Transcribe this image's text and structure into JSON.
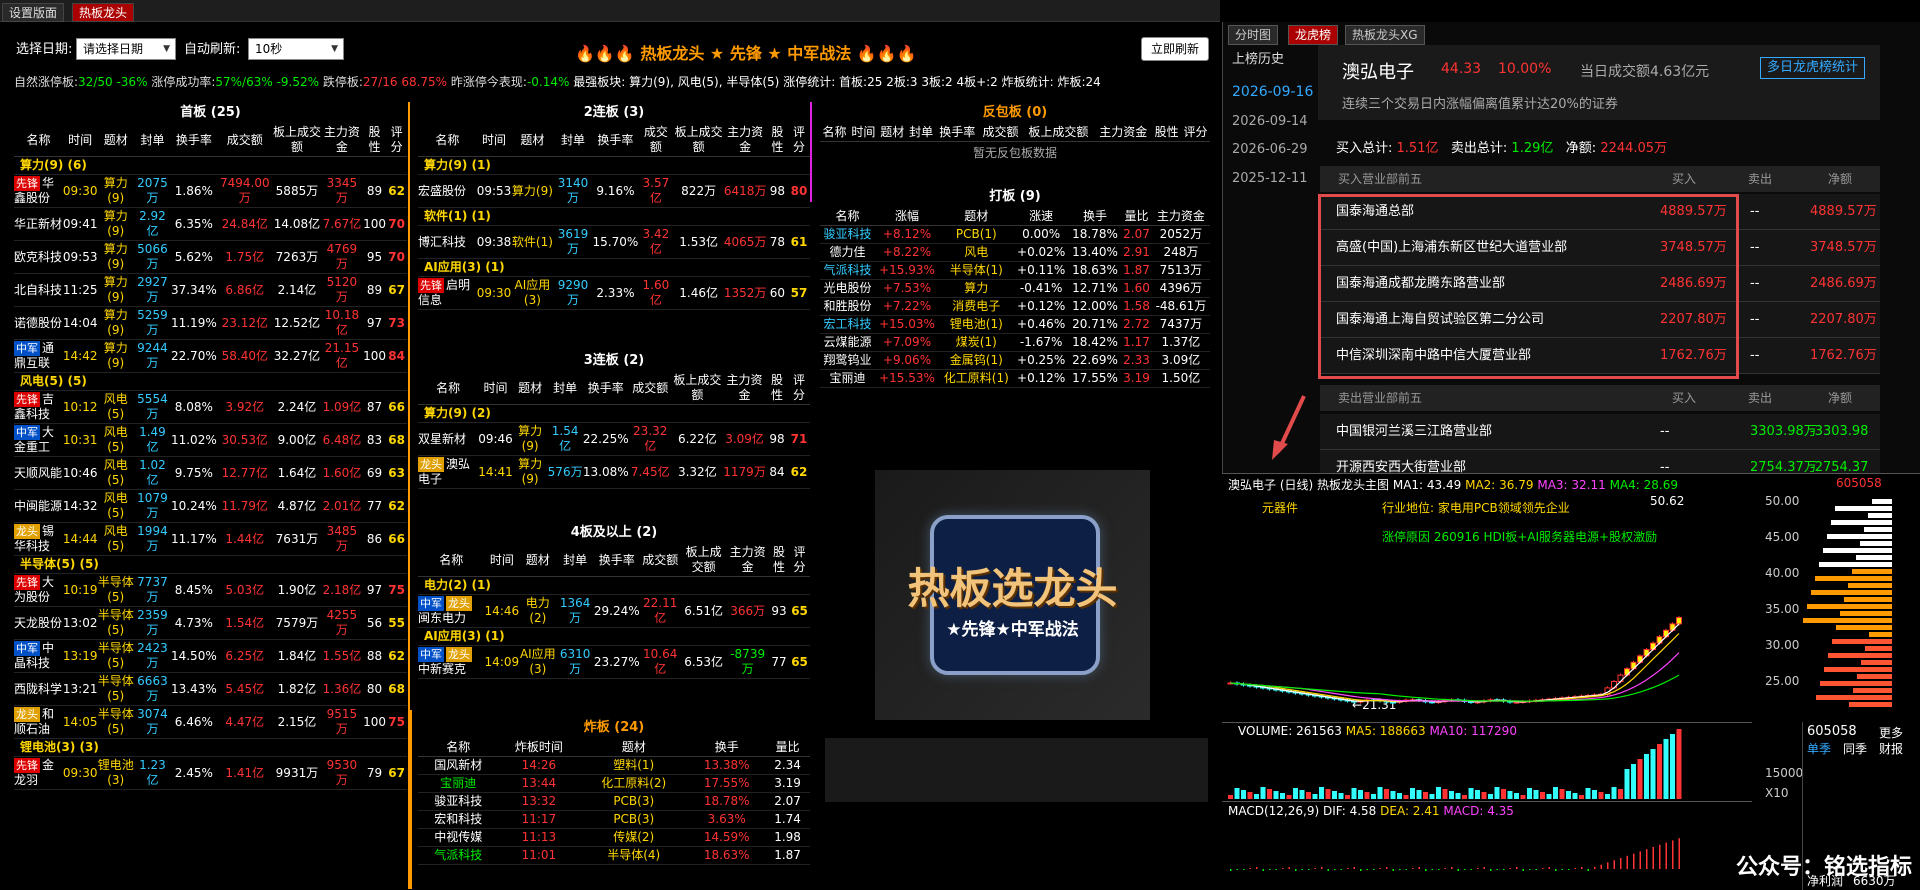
{
  "tabs": [
    "设置版面",
    "热板龙头"
  ],
  "toolbar": {
    "date_label": "选择日期:",
    "date_value": "请选择日期",
    "refresh_label": "自动刷新:",
    "refresh_value": "10秒",
    "title": "🔥🔥🔥 热板龙头 ★ 先锋 ★ 中军战法 🔥🔥🔥",
    "refresh_button": "立即刷新"
  },
  "stats": {
    "l1": "自然涨停板:",
    "v1": "32/50",
    "v2": "-36%",
    "l2": "涨停成功率:",
    "v3": "57%/63%",
    "v4": "-9.52%",
    "l3": "跌停板:",
    "v5": "27/16",
    "v6": "68.75%",
    "l4": "昨涨停今表现:",
    "v7": "-0.14%",
    "l5": "最强板块: 算力(9), 风电(5), 半导体(5)",
    "l6": "涨停统计: 首板:25 2板:3 3板:2 4板+:2 炸板统计: 炸板:24"
  },
  "headers": {
    "first": [
      "名称",
      "时间",
      "题材",
      "封单",
      "换手率",
      "成交额",
      "板上成交额",
      "主力资金",
      "股性",
      "评分"
    ],
    "dragon": [
      "名称",
      "涨幅",
      "题材",
      "涨速",
      "换手",
      "量比",
      "主力资金"
    ],
    "zhaban": [
      "名称",
      "炸板时间",
      "题材",
      "换手",
      "量比"
    ]
  },
  "first_board": {
    "title": "首板 (25)",
    "groups": [
      {
        "name": "算力(9) (6)",
        "rows": [
          {
            "badge": "先锋",
            "badge_type": "x",
            "name": "华鑫股份",
            "time": "09:30",
            "topic": "算力(9)",
            "seal": "2075万",
            "turn": "1.86%",
            "amount": "7494.00万",
            "board": "5885万",
            "main": "3345万",
            "xg": "89",
            "score": "62"
          },
          {
            "badge": "",
            "name": "华正新材",
            "time": "09:41",
            "topic": "算力(9)",
            "seal": "2.92亿",
            "turn": "6.35%",
            "amount": "24.84亿",
            "board": "14.08亿",
            "main": "7.67亿",
            "xg": "100",
            "score": "70"
          },
          {
            "badge": "",
            "name": "欧克科技",
            "time": "09:53",
            "topic": "算力(9)",
            "seal": "5066万",
            "turn": "5.62%",
            "amount": "1.75亿",
            "board": "7263万",
            "main": "4769万",
            "xg": "95",
            "score": "70"
          },
          {
            "badge": "",
            "name": "北自科技",
            "time": "11:25",
            "topic": "算力(9)",
            "seal": "2927万",
            "turn": "37.34%",
            "amount": "6.86亿",
            "board": "2.14亿",
            "main": "5120万",
            "xg": "89",
            "score": "67"
          },
          {
            "badge": "",
            "name": "诺德股份",
            "time": "14:04",
            "topic": "算力(9)",
            "seal": "5259万",
            "turn": "11.19%",
            "amount": "23.12亿",
            "board": "12.52亿",
            "main": "10.18亿",
            "xg": "97",
            "score": "73"
          },
          {
            "badge": "中军",
            "badge_type": "z",
            "name": "通鼎互联",
            "time": "14:42",
            "topic": "算力(9)",
            "seal": "9244万",
            "turn": "22.70%",
            "amount": "58.40亿",
            "board": "32.27亿",
            "main": "21.15亿",
            "xg": "100",
            "score": "84"
          }
        ]
      },
      {
        "name": "风电(5) (5)",
        "rows": [
          {
            "badge": "先锋",
            "badge_type": "x",
            "name": "吉鑫科技",
            "time": "10:12",
            "topic": "风电(5)",
            "seal": "5554万",
            "turn": "8.08%",
            "amount": "3.92亿",
            "board": "2.24亿",
            "main": "1.09亿",
            "xg": "87",
            "score": "66"
          },
          {
            "badge": "中军",
            "badge_type": "z",
            "name": "大金重工",
            "time": "10:31",
            "topic": "风电(5)",
            "seal": "1.49亿",
            "turn": "11.02%",
            "amount": "30.53亿",
            "board": "9.00亿",
            "main": "6.48亿",
            "xg": "83",
            "score": "68"
          },
          {
            "badge": "",
            "name": "天顺风能",
            "time": "10:46",
            "topic": "风电(5)",
            "seal": "1.02亿",
            "turn": "9.75%",
            "amount": "12.77亿",
            "board": "1.64亿",
            "main": "1.60亿",
            "xg": "69",
            "score": "63"
          },
          {
            "badge": "",
            "name": "中闽能源",
            "time": "14:32",
            "topic": "风电(5)",
            "seal": "1079万",
            "turn": "10.24%",
            "amount": "11.79亿",
            "board": "4.87亿",
            "main": "2.01亿",
            "xg": "77",
            "score": "62"
          },
          {
            "badge": "龙头",
            "badge_type": "l",
            "name": "锡华科技",
            "time": "14:44",
            "topic": "风电(5)",
            "seal": "1994万",
            "turn": "11.17%",
            "amount": "1.44亿",
            "board": "7631万",
            "main": "3485万",
            "xg": "86",
            "score": "66"
          }
        ]
      },
      {
        "name": "半导体(5) (5)",
        "rows": [
          {
            "badge": "先锋",
            "badge_type": "x",
            "name": "大为股份",
            "time": "10:19",
            "topic": "半导体(5)",
            "seal": "7737万",
            "turn": "8.45%",
            "amount": "5.03亿",
            "board": "1.90亿",
            "main": "2.18亿",
            "xg": "97",
            "score": "75"
          },
          {
            "badge": "",
            "name": "天龙股份",
            "time": "13:02",
            "topic": "半导体(5)",
            "seal": "2359万",
            "turn": "4.73%",
            "amount": "1.54亿",
            "board": "7579万",
            "main": "4255万",
            "xg": "56",
            "score": "55"
          },
          {
            "badge": "中军",
            "badge_type": "z",
            "name": "中晶科技",
            "time": "13:19",
            "topic": "半导体(5)",
            "seal": "2423万",
            "turn": "14.50%",
            "amount": "6.25亿",
            "board": "1.84亿",
            "main": "1.55亿",
            "xg": "88",
            "score": "62"
          },
          {
            "badge": "",
            "name": "西陇科学",
            "time": "13:21",
            "topic": "半导体(5)",
            "seal": "6663万",
            "turn": "13.43%",
            "amount": "5.45亿",
            "board": "1.82亿",
            "main": "1.36亿",
            "xg": "80",
            "score": "68"
          },
          {
            "badge": "龙头",
            "badge_type": "l",
            "name": "和顺石油",
            "time": "14:05",
            "topic": "半导体(5)",
            "seal": "3074万",
            "turn": "6.46%",
            "amount": "4.47亿",
            "board": "2.15亿",
            "main": "9515万",
            "xg": "100",
            "score": "75"
          }
        ]
      },
      {
        "name": "锂电池(3) (3)",
        "rows": [
          {
            "badge": "先锋",
            "badge_type": "x",
            "name": "金龙羽",
            "time": "09:30",
            "topic": "锂电池(3)",
            "seal": "1.23亿",
            "turn": "2.45%",
            "amount": "1.41亿",
            "board": "9931万",
            "main": "9530万",
            "xg": "79",
            "score": "67"
          }
        ]
      }
    ]
  },
  "second_board": {
    "title": "2连板 (3)",
    "groups": [
      {
        "name": "算力(9) (1)",
        "rows": [
          {
            "badge": "",
            "name": "宏盛股份",
            "time": "09:53",
            "topic": "算力(9)",
            "seal": "3140万",
            "turn": "9.16%",
            "amount": "3.57亿",
            "board": "822万",
            "main": "6418万",
            "xg": "98",
            "score": "80"
          }
        ]
      },
      {
        "name": "软件(1) (1)",
        "rows": [
          {
            "badge": "",
            "name": "博汇科技",
            "time": "09:38",
            "topic": "软件(1)",
            "seal": "3619万",
            "turn": "15.70%",
            "amount": "3.42亿",
            "board": "1.53亿",
            "main": "4065万",
            "xg": "78",
            "score": "61"
          }
        ]
      },
      {
        "name": "AI应用(3) (1)",
        "rows": [
          {
            "badge": "先锋",
            "badge_type": "x",
            "name": "启明信息",
            "time": "09:30",
            "topic": "AI应用(3)",
            "seal": "9290万",
            "turn": "2.33%",
            "amount": "1.60亿",
            "board": "1.46亿",
            "main": "1352万",
            "xg": "60",
            "score": "57"
          }
        ]
      }
    ]
  },
  "third_board": {
    "title": "3连板 (2)",
    "groups": [
      {
        "name": "算力(9) (2)",
        "rows": [
          {
            "badge": "",
            "name": "双星新材",
            "time": "09:46",
            "topic": "算力(9)",
            "seal": "1.54亿",
            "turn": "22.25%",
            "amount": "23.32亿",
            "board": "6.22亿",
            "main": "3.09亿",
            "xg": "98",
            "score": "71"
          },
          {
            "badge": "龙头",
            "badge_type": "l",
            "name": "澳弘电子",
            "time": "14:41",
            "topic": "算力(9)",
            "seal": "576万",
            "turn": "13.08%",
            "amount": "7.45亿",
            "board": "3.32亿",
            "main": "1179万",
            "xg": "84",
            "score": "62"
          }
        ]
      }
    ]
  },
  "fourth_board": {
    "title": "4板及以上 (2)",
    "groups": [
      {
        "name": "电力(2) (1)",
        "rows": [
          {
            "badge": "中军",
            "badge_type": "z",
            "badge2": "龙头",
            "name": "闽东电力",
            "time": "14:46",
            "topic": "电力(2)",
            "seal": "1364万",
            "turn": "29.24%",
            "amount": "22.11亿",
            "board": "6.51亿",
            "main": "366万",
            "xg": "93",
            "score": "65"
          }
        ]
      },
      {
        "name": "AI应用(3) (1)",
        "rows": [
          {
            "badge": "中军",
            "badge_type": "z",
            "badge2": "龙头",
            "name": "中新赛克",
            "time": "14:09",
            "topic": "AI应用(3)",
            "seal": "6310万",
            "turn": "23.27%",
            "amount": "10.64亿",
            "board": "6.53亿",
            "main": "-8739万",
            "xg": "77",
            "score": "65"
          }
        ]
      }
    ]
  },
  "reverse": {
    "title": "反包板 (0)",
    "empty": "暂无反包板数据"
  },
  "dragon": {
    "title": "打板 (9)",
    "rows": [
      {
        "name": "骏亚科技",
        "chg": "+8.12%",
        "topic": "PCB(1)",
        "speed": "0.00%",
        "turn": "18.78%",
        "vr": "2.07",
        "main": "2052万",
        "c": "b"
      },
      {
        "name": "德力佳",
        "chg": "+8.22%",
        "topic": "风电",
        "speed": "+0.02%",
        "turn": "13.40%",
        "vr": "2.91",
        "main": "248万",
        "c": "w"
      },
      {
        "name": "气派科技",
        "chg": "+15.93%",
        "topic": "半导体(1)",
        "speed": "+0.11%",
        "turn": "18.63%",
        "vr": "1.87",
        "main": "7513万",
        "c": "b"
      },
      {
        "name": "光电股份",
        "chg": "+7.53%",
        "topic": "算力",
        "speed": "-0.41%",
        "turn": "12.71%",
        "vr": "1.60",
        "main": "4396万",
        "c": "w"
      },
      {
        "name": "和胜股份",
        "chg": "+7.22%",
        "topic": "消费电子",
        "speed": "+0.12%",
        "turn": "12.00%",
        "vr": "1.58",
        "main": "-48.61万",
        "c": "w"
      },
      {
        "name": "宏工科技",
        "chg": "+15.03%",
        "topic": "锂电池(1)",
        "speed": "+0.46%",
        "turn": "20.71%",
        "vr": "2.72",
        "main": "7437万",
        "c": "b"
      },
      {
        "name": "云煤能源",
        "chg": "+7.09%",
        "topic": "煤炭(1)",
        "speed": "-1.67%",
        "turn": "18.42%",
        "vr": "1.17",
        "main": "1.37亿",
        "c": "w"
      },
      {
        "name": "翔鹭钨业",
        "chg": "+9.06%",
        "topic": "金属钨(1)",
        "speed": "+0.25%",
        "turn": "22.69%",
        "vr": "2.33",
        "main": "3.09亿",
        "c": "w"
      },
      {
        "name": "宝丽迪",
        "chg": "+15.53%",
        "topic": "化工原料(1)",
        "speed": "+0.12%",
        "turn": "17.55%",
        "vr": "3.19",
        "main": "1.50亿",
        "c": "w"
      }
    ]
  },
  "zhaban": {
    "title": "炸板 (24)",
    "rows": [
      {
        "name": "国风新材",
        "time": "14:26",
        "topic": "塑料(1)",
        "turn": "13.38%",
        "vr": "2.34"
      },
      {
        "name": "宝丽迪",
        "time": "13:44",
        "topic": "化工原料(2)",
        "turn": "17.55%",
        "vr": "3.19"
      },
      {
        "name": "骏亚科技",
        "time": "13:32",
        "topic": "PCB(3)",
        "turn": "18.78%",
        "vr": "2.07"
      },
      {
        "name": "宏和科技",
        "time": "11:17",
        "topic": "PCB(3)",
        "turn": "3.63%",
        "vr": "1.74"
      },
      {
        "name": "中视传媒",
        "time": "11:13",
        "topic": "传媒(2)",
        "turn": "14.59%",
        "vr": "1.98"
      },
      {
        "name": "气派科技",
        "time": "11:01",
        "topic": "半导体(4)",
        "turn": "18.63%",
        "vr": "1.87"
      }
    ]
  },
  "logo": {
    "t1": "热板选龙头",
    "t2": "★先锋★中军战法"
  },
  "right": {
    "tabs": [
      "分时图",
      "龙虎榜",
      "热板龙头XG"
    ],
    "history_label": "上榜历史",
    "dates": [
      "2026-09-16",
      "2026-09-14",
      "2026-06-29",
      "2025-12-11"
    ],
    "stock": "澳弘电子",
    "price": "44.33",
    "pct": "10.00%",
    "turnover": "当日成交额4.63亿元",
    "multi_btn": "多日龙虎榜统计",
    "reason": "连续三个交易日内涨幅偏离值累计达20%的证券",
    "buy_total_label": "买入总计:",
    "buy_total": "1.51亿",
    "sell_total_label": "卖出总计:",
    "sell_total": "1.29亿",
    "net_label": "净额:",
    "net": "2244.05万",
    "buy_header": [
      "买入营业部前五",
      "买入",
      "卖出",
      "净额"
    ],
    "buy_rows": [
      {
        "name": "国泰海通总部",
        "buy": "4889.57万",
        "sell": "--",
        "net": "4889.57万"
      },
      {
        "name": "高盛(中国)上海浦东新区世纪大道营业部",
        "buy": "3748.57万",
        "sell": "--",
        "net": "3748.57万"
      },
      {
        "name": "国泰海通成都龙腾东路营业部",
        "buy": "2486.69万",
        "sell": "--",
        "net": "2486.69万"
      },
      {
        "name": "国泰海通上海自贸试验区第二分公司",
        "buy": "2207.80万",
        "sell": "--",
        "net": "2207.80万"
      },
      {
        "name": "中信深圳深南中路中信大厦营业部",
        "buy": "1762.76万",
        "sell": "--",
        "net": "1762.76万"
      }
    ],
    "sell_header": [
      "卖出营业部前五",
      "买入",
      "卖出",
      "净额"
    ],
    "sell_rows": [
      {
        "name": "中国银河兰溪三江路营业部",
        "buy": "--",
        "sell": "3303.98万",
        "net": "-3303.98万"
      },
      {
        "name": "开源西安西大街营业部",
        "buy": "--",
        "sell": "2754.37万",
        "net": "-2754.37万"
      }
    ]
  },
  "chart": {
    "title": "澳弘电子 (日线)",
    "main": "热板龙头主图",
    "ma1": "MA1: 43.49",
    "ma2": "MA2: 36.79",
    "ma3": "MA3: 32.11",
    "ma4": "MA4: 28.69",
    "industry": "行业地位: 家电用PCB领域领先企业",
    "component": "元器件",
    "reason": "涨停原因 260916 HDI板+AI服务器电源+股权激励",
    "high": "50.62",
    "low": "21.31",
    "yaxis": [
      "50.00",
      "45.00",
      "40.00",
      "35.00",
      "30.00",
      "25.00"
    ],
    "volume": "VOLUME: 261563",
    "vma5": "MA5: 188663",
    "vma10": "MA10: 117290",
    "vol_y": [
      "15000",
      "X10"
    ],
    "macd": "MACD(12,26,9)",
    "dif": "DIF: 4.58",
    "dea": "DEA: 2.41",
    "macd_v": "MACD: 4.35",
    "code": "605058",
    "side_code": "605058",
    "side_more": "更多",
    "side_tabs": [
      "单季",
      "同季",
      "财报"
    ],
    "profit_label": "净利润",
    "profit": "6630万",
    "markers": [
      "财",
      "激",
      "溢涨"
    ]
  },
  "watermark": "公众号：铭选指标"
}
